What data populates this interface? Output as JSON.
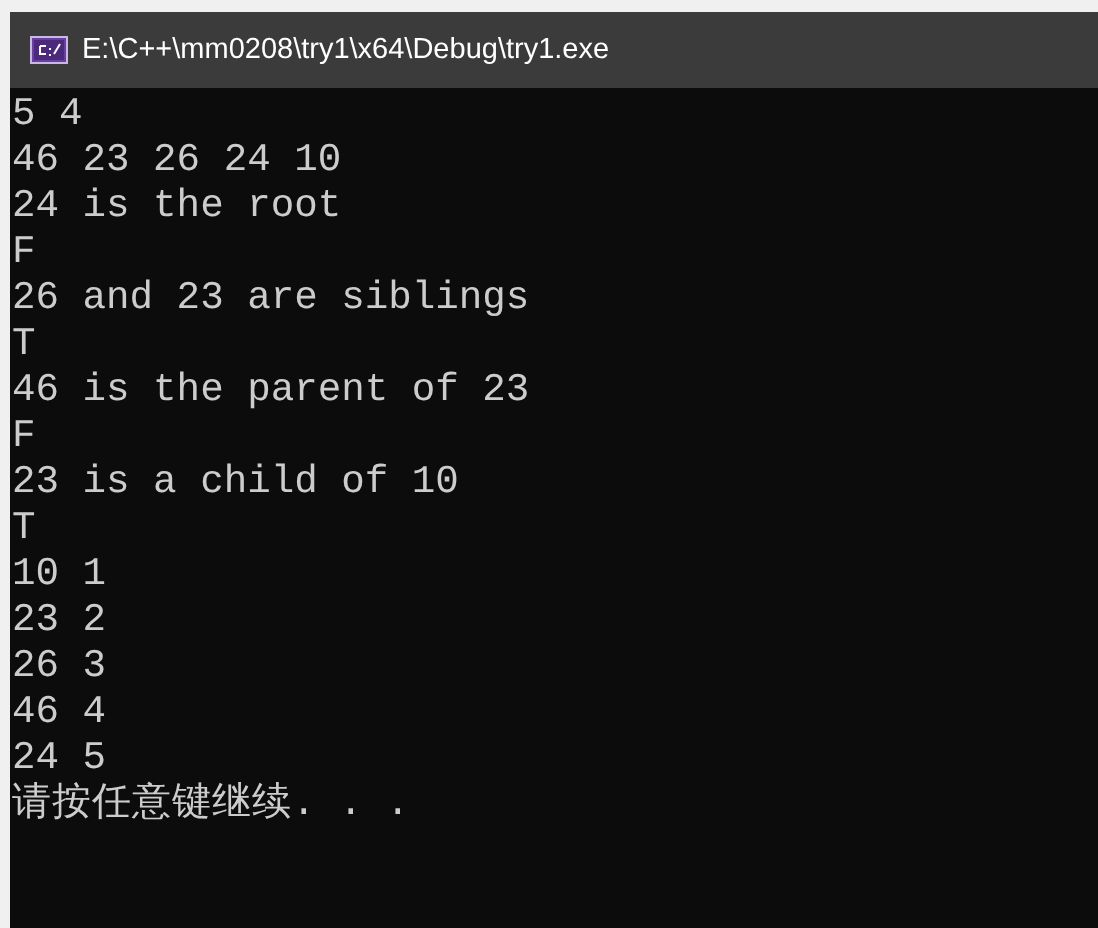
{
  "window": {
    "title": "E:\\C++\\mm0208\\try1\\x64\\Debug\\try1.exe"
  },
  "console_lines": [
    "5 4",
    "46 23 26 24 10",
    "24 is the root",
    "F",
    "26 and 23 are siblings",
    "T",
    "46 is the parent of 23",
    "F",
    "23 is a child of 10",
    "T",
    "10 1",
    "23 2",
    "26 3",
    "46 4",
    "24 5",
    "请按任意键继续. . ."
  ]
}
